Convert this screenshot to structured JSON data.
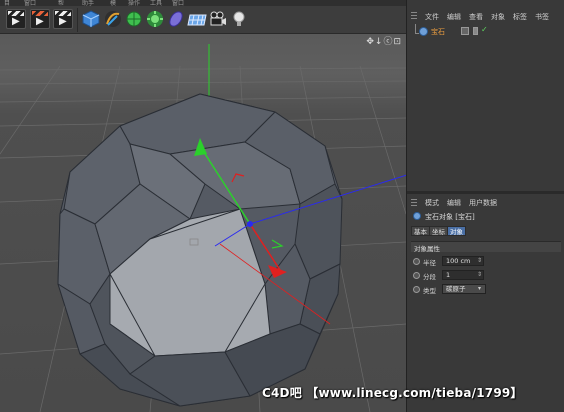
{
  "window": {
    "top_menu_fragments": [
      "目",
      "窗口",
      "帮",
      "助手",
      "模",
      "操作",
      "工具",
      "窗口"
    ]
  },
  "toolbar": {
    "icons": [
      "render-view-icon",
      "render-settings-icon",
      "edit-render-settings-icon",
      "cube-primitive-icon",
      "spline-pen-icon",
      "subdivision-surface-icon",
      "generator-icon",
      "deformer-icon",
      "floor-grid-icon",
      "camera-icon",
      "light-bulb-icon"
    ]
  },
  "viewport": {
    "nav_icons": "✥↓ⓒ⊡"
  },
  "object_manager": {
    "menu": [
      "文件",
      "编辑",
      "查看",
      "对象",
      "标签",
      "书签"
    ],
    "objects": [
      {
        "name": "宝石",
        "icon": "gem-object-icon",
        "visible_check": "✓"
      }
    ]
  },
  "attribute_manager": {
    "menu": [
      "模式",
      "编辑",
      "用户数据"
    ],
    "object_title": "宝石对象 [宝石]",
    "tabs": [
      {
        "label": "基本",
        "active": false
      },
      {
        "label": "坐标",
        "active": false
      },
      {
        "label": "对象",
        "active": true
      }
    ],
    "section_title": "对象属性",
    "fields": {
      "radius": {
        "label": "半径",
        "value": "100 cm"
      },
      "segments": {
        "label": "分段",
        "value": "1"
      },
      "type": {
        "label": "类型",
        "value": "碳原子"
      }
    }
  },
  "watermark": {
    "text": "C4D吧 【www.linecg.com/tieba/1799】"
  },
  "colors": {
    "accent_tab": "#4a6fa5",
    "object_name": "#f0a040",
    "y_axis": "#2bd12b",
    "x_axis": "#e02020",
    "z_axis": "#2a2af0"
  }
}
